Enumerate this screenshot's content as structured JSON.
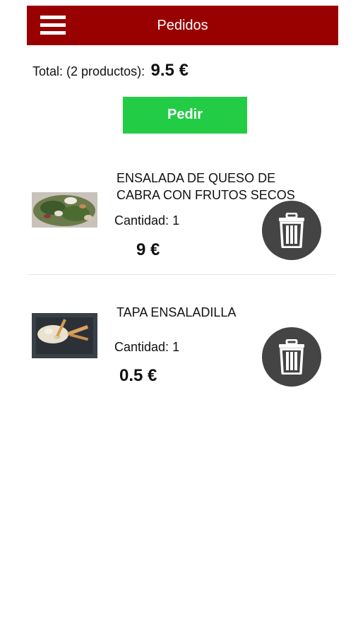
{
  "header": {
    "title": "Pedidos",
    "menu_icon": "hamburger-menu-icon"
  },
  "summary": {
    "total_label": "Total: (2 productos):",
    "total_value": "9.5 €"
  },
  "actions": {
    "order_label": "Pedir"
  },
  "items": [
    {
      "name": "ENSALADA DE QUESO DE CABRA CON FRUTOS SECOS",
      "quantity_label": "Cantidad:",
      "quantity": "1",
      "price": "9 €",
      "image": "salad-photo",
      "delete_icon": "trash-icon"
    },
    {
      "name": "TAPA ENSALADILLA",
      "quantity_label": "Cantidad:",
      "quantity": "1",
      "price": "0.5 €",
      "image": "tapa-photo",
      "delete_icon": "trash-icon"
    }
  ],
  "colors": {
    "header_background": "#990000",
    "order_button": "#22cc44",
    "delete_button": "#444444"
  }
}
